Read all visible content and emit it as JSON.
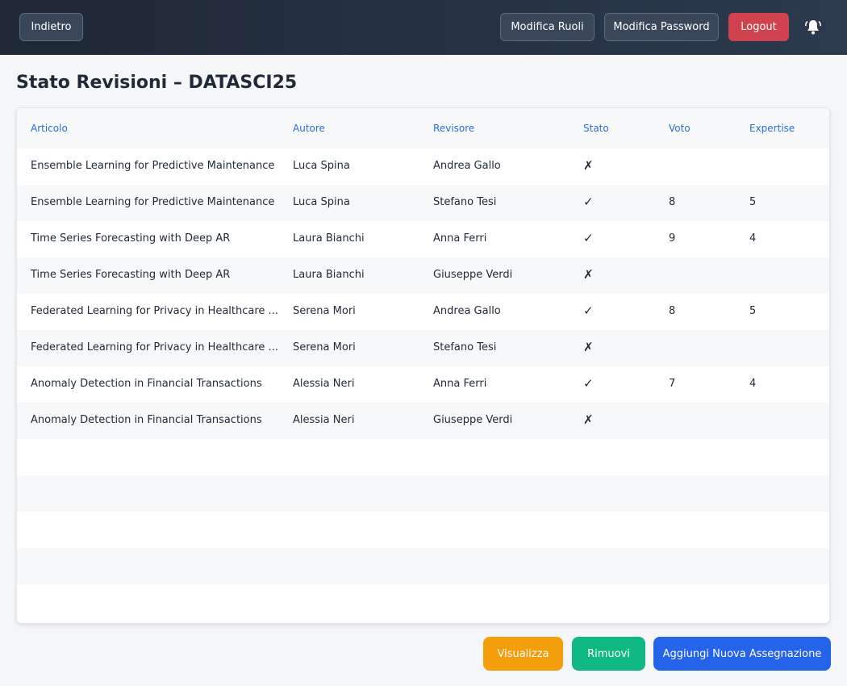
{
  "header": {
    "back_label": "Indietro",
    "edit_roles_label": "Modifica Ruoli",
    "edit_password_label": "Modifica Password",
    "logout_label": "Logout",
    "notification_icon": "bell-icon"
  },
  "page": {
    "title": "Stato Revisioni – DATASCI25"
  },
  "table": {
    "columns": [
      "Articolo",
      "Autore",
      "Revisore",
      "Stato",
      "Voto",
      "Expertise"
    ],
    "rows": [
      {
        "articolo": "Ensemble Learning for Predictive Maintenance",
        "autore": "Luca Spina",
        "revisore": "Andrea Gallo",
        "stato": "✗",
        "voto": "",
        "expertise": ""
      },
      {
        "articolo": "Ensemble Learning for Predictive Maintenance",
        "autore": "Luca Spina",
        "revisore": "Stefano Tesi",
        "stato": "✓",
        "voto": "8",
        "expertise": "5"
      },
      {
        "articolo": "Time Series Forecasting with Deep AR",
        "autore": "Laura Bianchi",
        "revisore": "Anna Ferri",
        "stato": "✓",
        "voto": "9",
        "expertise": "4"
      },
      {
        "articolo": "Time Series Forecasting with Deep AR",
        "autore": "Laura Bianchi",
        "revisore": "Giuseppe Verdi",
        "stato": "✗",
        "voto": "",
        "expertise": ""
      },
      {
        "articolo": "Federated Learning for Privacy in Healthcare ...",
        "autore": "Serena Mori",
        "revisore": "Andrea Gallo",
        "stato": "✓",
        "voto": "8",
        "expertise": "5"
      },
      {
        "articolo": "Federated Learning for Privacy in Healthcare ...",
        "autore": "Serena Mori",
        "revisore": "Stefano Tesi",
        "stato": "✗",
        "voto": "",
        "expertise": ""
      },
      {
        "articolo": "Anomaly Detection in Financial Transactions",
        "autore": "Alessia Neri",
        "revisore": "Anna Ferri",
        "stato": "✓",
        "voto": "7",
        "expertise": "4"
      },
      {
        "articolo": "Anomaly Detection in Financial Transactions",
        "autore": "Alessia Neri",
        "revisore": "Giuseppe Verdi",
        "stato": "✗",
        "voto": "",
        "expertise": ""
      }
    ]
  },
  "actions": {
    "view_label": "Visualizza",
    "remove_label": "Rimuovi",
    "add_label": "Aggiungi Nuova Assegnazione"
  },
  "colors": {
    "header_bg": "#1e2735",
    "logout": "#d0434e",
    "link": "#2b6cd9",
    "view": "#f59e0b",
    "remove": "#10b981",
    "add": "#2563eb"
  }
}
